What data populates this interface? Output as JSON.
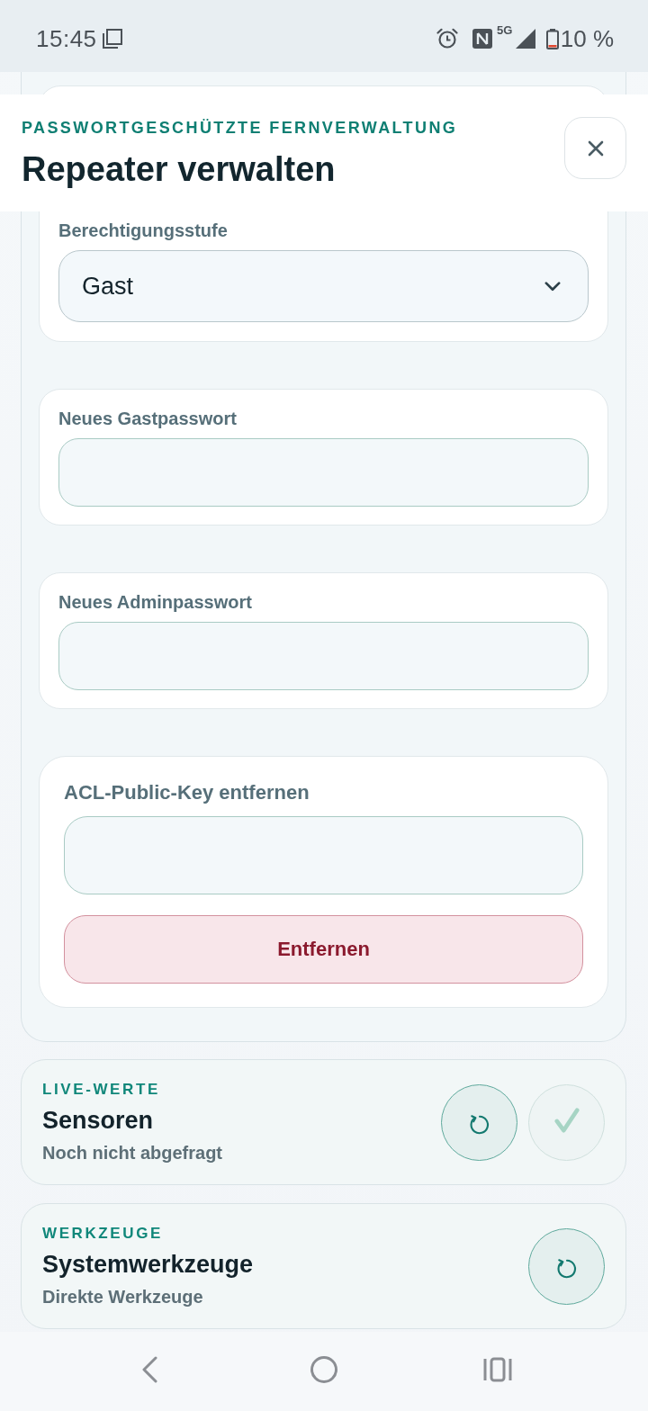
{
  "status_bar": {
    "time": "15:45",
    "network": "5G",
    "battery": "10 %"
  },
  "header": {
    "kicker": "PASSWORTGESCHÜTZTE FERNVERWALTUNG",
    "title": "Repeater verwalten"
  },
  "form": {
    "cards": [
      {
        "kind": "select",
        "label": "Berechtigungsstufe",
        "value": "Gast"
      },
      {
        "kind": "input",
        "label": "Neues Gastpasswort"
      },
      {
        "kind": "input",
        "label": "Neues Adminpasswort"
      },
      {
        "kind": "action",
        "label": "ACL-Public-Key entfernen",
        "button": "Entfernen"
      }
    ]
  },
  "sections": [
    {
      "kicker": "LIVE-WERTE",
      "title": "Sensoren",
      "subtitle": "Noch nicht abgefragt",
      "actions": [
        {
          "kind": "refresh",
          "disabled": false
        },
        {
          "kind": "confirm",
          "disabled": true
        }
      ]
    },
    {
      "kicker": "WERKZEUGE",
      "title": "Systemwerkzeuge",
      "subtitle": "Direkte Werkzeuge",
      "actions": [
        {
          "kind": "refresh",
          "disabled": false
        }
      ]
    }
  ]
}
